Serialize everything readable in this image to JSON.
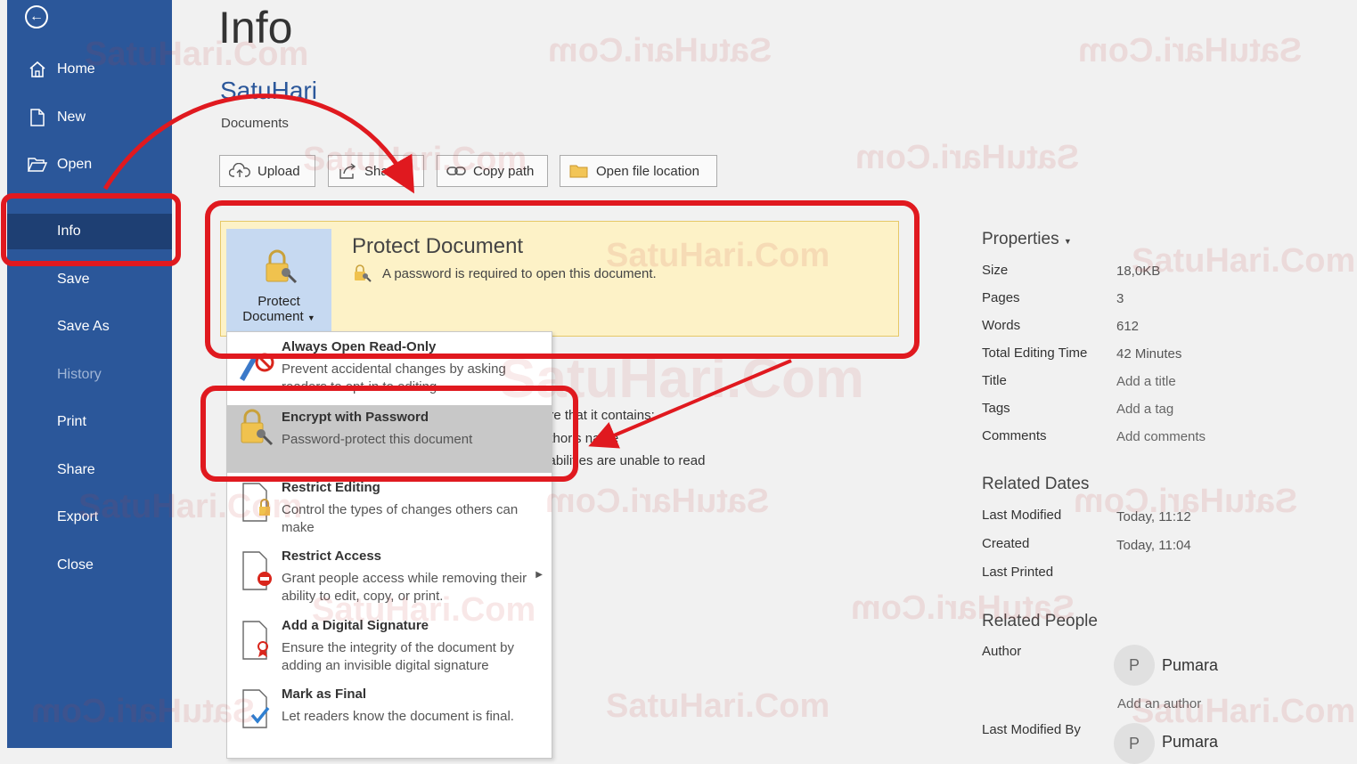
{
  "sidebar": {
    "items": [
      {
        "label": "Home",
        "icon": "home-icon"
      },
      {
        "label": "New",
        "icon": "new-document-icon"
      },
      {
        "label": "Open",
        "icon": "folder-open-icon"
      },
      {
        "label": "Info"
      },
      {
        "label": "Save"
      },
      {
        "label": "Save As"
      },
      {
        "label": "History"
      },
      {
        "label": "Print"
      },
      {
        "label": "Share"
      },
      {
        "label": "Export"
      },
      {
        "label": "Close"
      }
    ]
  },
  "main": {
    "title": "Info",
    "doc_name": "SatuHari",
    "doc_path": "Documents",
    "toolbar": {
      "upload": "Upload",
      "share": "Share",
      "copy_path": "Copy path",
      "open_location": "Open file location"
    },
    "protect": {
      "button_line1": "Protect",
      "button_line2": "Document",
      "title": "Protect Document",
      "description": "A password is required to open this document."
    },
    "menu": [
      {
        "title": "Always Open Read-Only",
        "desc": "Prevent accidental changes by asking readers to opt-in to editing."
      },
      {
        "title": "Encrypt with Password",
        "desc": "Password-protect this document"
      },
      {
        "title": "Restrict Editing",
        "desc": "Control the types of changes others can make"
      },
      {
        "title": "Restrict Access",
        "desc": "Grant people access while removing their ability to edit, copy, or print."
      },
      {
        "title": "Add a Digital Signature",
        "desc": "Ensure the integrity of the document by adding an invisible digital signature"
      },
      {
        "title": "Mark as Final",
        "desc": "Let readers know the document is final."
      }
    ],
    "background_text": {
      "line1": "are that it contains:",
      "line2": "uthor's name",
      "line3": "sabilities are unable to read"
    }
  },
  "properties": {
    "heading": "Properties",
    "rows": [
      {
        "label": "Size",
        "value": "18,0KB"
      },
      {
        "label": "Pages",
        "value": "3"
      },
      {
        "label": "Words",
        "value": "612"
      },
      {
        "label": "Total Editing Time",
        "value": "42 Minutes"
      },
      {
        "label": "Title",
        "value": "Add a title"
      },
      {
        "label": "Tags",
        "value": "Add a tag"
      },
      {
        "label": "Comments",
        "value": "Add comments"
      }
    ],
    "related_dates": {
      "heading": "Related Dates",
      "rows": [
        {
          "label": "Last Modified",
          "value": "Today, 11:12"
        },
        {
          "label": "Created",
          "value": "Today, 11:04"
        },
        {
          "label": "Last Printed",
          "value": ""
        }
      ]
    },
    "related_people": {
      "heading": "Related People",
      "author_label": "Author",
      "author_initial": "P",
      "author_name": "Pumara",
      "add_author": "Add an author",
      "last_modified_by_label": "Last Modified By",
      "last_modified_initial": "P",
      "last_modified_name": "Pumara"
    }
  },
  "watermark": "SatuHari.Com",
  "colors": {
    "sidebar": "#2b579a",
    "annotation": "#e0191f",
    "protect_bg": "#fdf2c7"
  }
}
